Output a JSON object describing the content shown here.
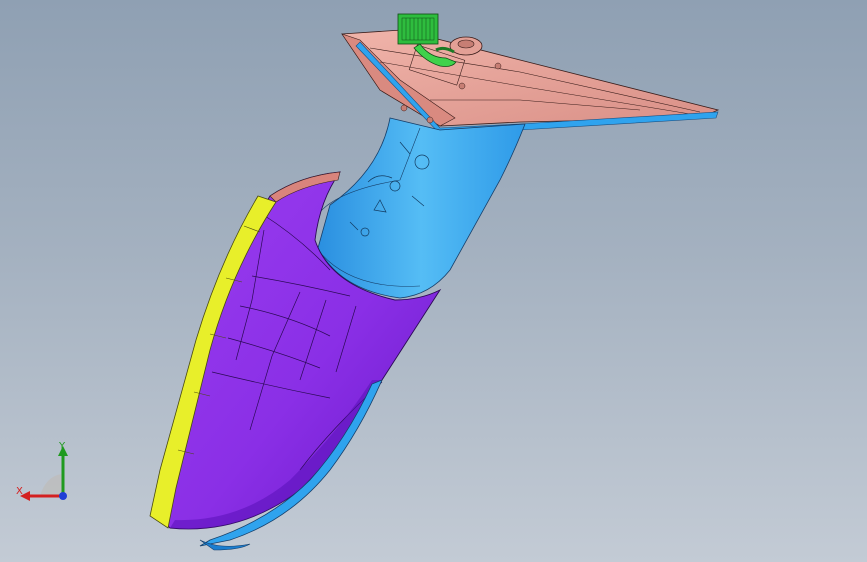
{
  "viewport": {
    "background_top": "#8fa0b3",
    "background_bottom": "#c3cbd5"
  },
  "model": {
    "colors": {
      "housing": "#8a2fe6",
      "housing_shadow": "#5a10b8",
      "rim": "#e8ef2a",
      "base": "#2fa3ee",
      "base_light": "#63c4f7",
      "flange": "#e8a59c",
      "connector": "#2ebd3e"
    }
  },
  "triad": {
    "x_label": "X",
    "y_label": "Y",
    "x_color": "#d42020",
    "y_color": "#1f9a1f",
    "z_color": "#1f3fd6"
  }
}
